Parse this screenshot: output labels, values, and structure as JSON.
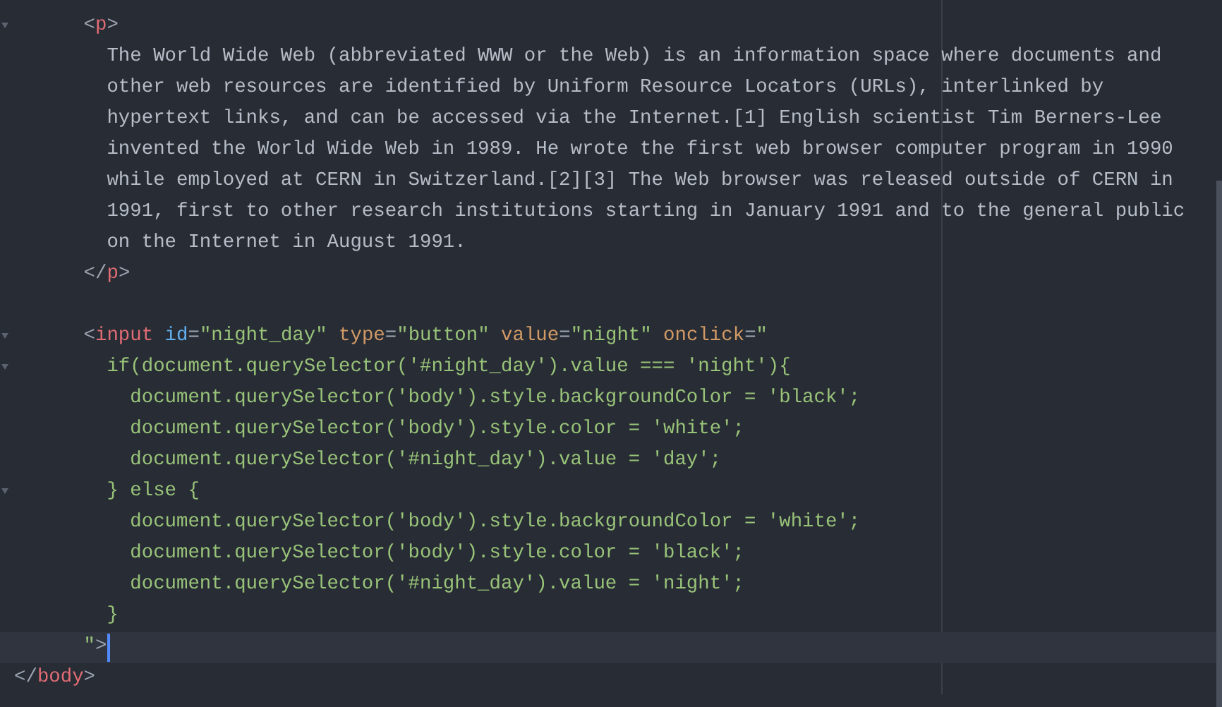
{
  "lines": [
    {
      "foldable": true,
      "current": false,
      "tokens": [
        {
          "kind": "punct",
          "text": "      <"
        },
        {
          "kind": "tag",
          "text": "p"
        },
        {
          "kind": "punct",
          "text": ">"
        }
      ]
    },
    {
      "foldable": false,
      "current": false,
      "tokens": [
        {
          "kind": "text",
          "text": "        The World Wide Web (abbreviated WWW or the Web) is an information space where documents and"
        }
      ]
    },
    {
      "foldable": false,
      "current": false,
      "tokens": [
        {
          "kind": "text",
          "text": "        other web resources are identified by Uniform Resource Locators (URLs), interlinked by"
        }
      ]
    },
    {
      "foldable": false,
      "current": false,
      "tokens": [
        {
          "kind": "text",
          "text": "        hypertext links, and can be accessed via the Internet.[1] English scientist Tim Berners-Lee"
        }
      ]
    },
    {
      "foldable": false,
      "current": false,
      "tokens": [
        {
          "kind": "text",
          "text": "        invented the World Wide Web in 1989. He wrote the first web browser computer program in 1990"
        }
      ]
    },
    {
      "foldable": false,
      "current": false,
      "tokens": [
        {
          "kind": "text",
          "text": "        while employed at CERN in Switzerland.[2][3] The Web browser was released outside of CERN in"
        }
      ]
    },
    {
      "foldable": false,
      "current": false,
      "tokens": [
        {
          "kind": "text",
          "text": "        1991, first to other research institutions starting in January 1991 and to the general public"
        }
      ]
    },
    {
      "foldable": false,
      "current": false,
      "tokens": [
        {
          "kind": "text",
          "text": "        on the Internet in August 1991."
        }
      ]
    },
    {
      "foldable": false,
      "current": false,
      "tokens": [
        {
          "kind": "punct",
          "text": "      </"
        },
        {
          "kind": "tag",
          "text": "p"
        },
        {
          "kind": "punct",
          "text": ">"
        }
      ]
    },
    {
      "foldable": false,
      "current": false
    },
    {
      "foldable": true,
      "current": false,
      "tokens": [
        {
          "kind": "punct",
          "text": "      <"
        },
        {
          "kind": "tag",
          "text": "input"
        },
        {
          "kind": "attr-id",
          "text": " id"
        },
        {
          "kind": "punct",
          "text": "="
        },
        {
          "kind": "string",
          "text": "\"night_day\""
        },
        {
          "kind": "attr",
          "text": " type"
        },
        {
          "kind": "punct",
          "text": "="
        },
        {
          "kind": "string",
          "text": "\"button\""
        },
        {
          "kind": "attr",
          "text": " value"
        },
        {
          "kind": "punct",
          "text": "="
        },
        {
          "kind": "string",
          "text": "\"night\""
        },
        {
          "kind": "attr",
          "text": " onclick"
        },
        {
          "kind": "punct",
          "text": "="
        },
        {
          "kind": "string",
          "text": "\""
        }
      ]
    },
    {
      "foldable": true,
      "current": false,
      "tokens": [
        {
          "kind": "string",
          "text": "        if(document.querySelector('#night_day').value === 'night'){"
        }
      ]
    },
    {
      "foldable": false,
      "current": false,
      "tokens": [
        {
          "kind": "string",
          "text": "          document.querySelector('body').style.backgroundColor = 'black';"
        }
      ]
    },
    {
      "foldable": false,
      "current": false,
      "tokens": [
        {
          "kind": "string",
          "text": "          document.querySelector('body').style.color = 'white';"
        }
      ]
    },
    {
      "foldable": false,
      "current": false,
      "tokens": [
        {
          "kind": "string",
          "text": "          document.querySelector('#night_day').value = 'day';"
        }
      ]
    },
    {
      "foldable": true,
      "current": false,
      "tokens": [
        {
          "kind": "string",
          "text": "        } else {"
        }
      ]
    },
    {
      "foldable": false,
      "current": false,
      "tokens": [
        {
          "kind": "string",
          "text": "          document.querySelector('body').style.backgroundColor = 'white';"
        }
      ]
    },
    {
      "foldable": false,
      "current": false,
      "tokens": [
        {
          "kind": "string",
          "text": "          document.querySelector('body').style.color = 'black';"
        }
      ]
    },
    {
      "foldable": false,
      "current": false,
      "tokens": [
        {
          "kind": "string",
          "text": "          document.querySelector('#night_day').value = 'night';"
        }
      ]
    },
    {
      "foldable": false,
      "current": false,
      "tokens": [
        {
          "kind": "string",
          "text": "        }"
        }
      ]
    },
    {
      "foldable": false,
      "current": true,
      "tokens": [
        {
          "kind": "string",
          "text": "      \""
        },
        {
          "kind": "punct",
          "text": ">"
        }
      ]
    },
    {
      "foldable": false,
      "current": false,
      "tokens": [
        {
          "kind": "punct",
          "text": "</"
        },
        {
          "kind": "tag",
          "text": "body"
        },
        {
          "kind": "punct",
          "text": ">"
        }
      ]
    }
  ]
}
